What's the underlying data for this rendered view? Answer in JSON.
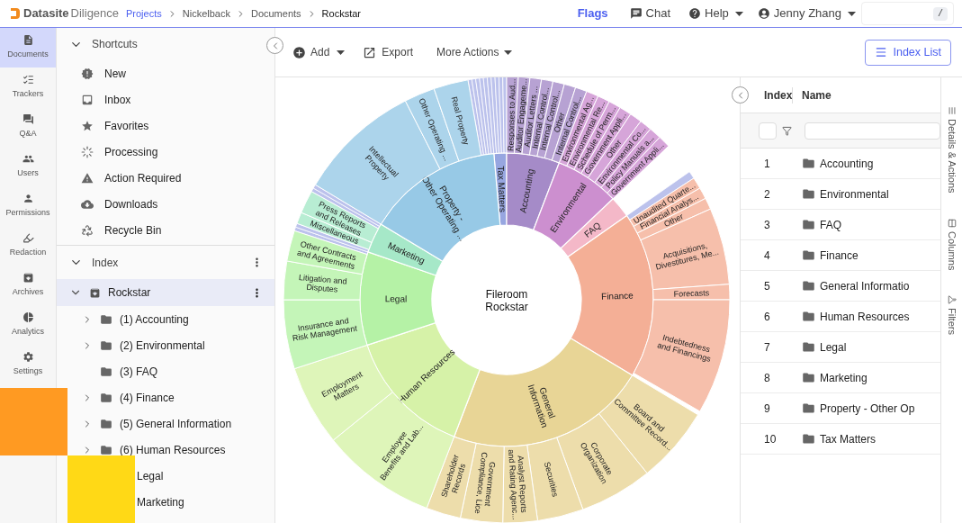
{
  "header": {
    "brand": "Datasite",
    "product": "Diligence",
    "breadcrumb": [
      {
        "label": "Projects",
        "link": true
      },
      {
        "label": "Nickelback",
        "link": false
      },
      {
        "label": "Documents",
        "link": false
      },
      {
        "label": "Rockstar",
        "link": false
      }
    ],
    "flags": "Flags",
    "chat": "Chat",
    "help": "Help",
    "user": "Jenny Zhang",
    "search_shortcut": "/"
  },
  "nav_rail": [
    {
      "label": "Documents",
      "selected": true
    },
    {
      "label": "Trackers",
      "selected": false
    },
    {
      "label": "Q&A",
      "selected": false
    },
    {
      "label": "Users",
      "selected": false
    },
    {
      "label": "Permissions",
      "selected": false
    },
    {
      "label": "Redaction",
      "selected": false
    },
    {
      "label": "Archives",
      "selected": false
    },
    {
      "label": "Analytics",
      "selected": false
    },
    {
      "label": "Settings",
      "selected": false
    }
  ],
  "shortcuts": {
    "title": "Shortcuts",
    "expanded": true,
    "items": [
      "New",
      "Inbox",
      "Favorites",
      "Processing",
      "Action Required",
      "Downloads",
      "Recycle Bin"
    ]
  },
  "index_tree": {
    "title": "Index",
    "expanded": true,
    "root": {
      "label": "Rockstar",
      "expanded": true,
      "selected": true,
      "children": [
        {
          "label": "(1) Accounting",
          "kind": "folder",
          "expandable": true
        },
        {
          "label": "(2) Environmental",
          "kind": "folder",
          "expandable": true
        },
        {
          "label": "(3) FAQ",
          "kind": "folder",
          "expandable": false
        },
        {
          "label": "(4) Finance",
          "kind": "folder",
          "expandable": true
        },
        {
          "label": "(5) General Information",
          "kind": "folder",
          "expandable": true
        },
        {
          "label": "(6) Human Resources",
          "kind": "folder",
          "expandable": true
        },
        {
          "label": "Legal",
          "kind": "covered"
        },
        {
          "label": "Marketing",
          "kind": "covered"
        }
      ]
    }
  },
  "toolbar": {
    "add": "Add",
    "export": "Export",
    "more": "More Actions",
    "index_list": "Index List"
  },
  "chart": {
    "center_lines": [
      "Fileroom",
      "Rockstar"
    ],
    "categories": [
      {
        "lines": [
          "Tax Matters"
        ],
        "color": "#97a6e0"
      },
      {
        "lines": [
          "Accounting"
        ],
        "color": "#a58bc8",
        "children": [
          {
            "lines": [
              "Responses to Aud..."
            ]
          },
          {
            "lines": [
              "Auditor Engageme..."
            ]
          },
          {
            "lines": [
              "Auditor Letters ..."
            ]
          },
          {
            "lines": [
              "Internal Control..."
            ]
          },
          {
            "lines": [
              "Internal Control..."
            ]
          },
          {
            "lines": [
              "Other"
            ]
          },
          {
            "lines": [
              "Internal Control..."
            ]
          }
        ]
      },
      {
        "lines": [
          "Environmental"
        ],
        "color": "#cc8fcf",
        "children": [
          {
            "lines": [
              "Environmental Ag..."
            ]
          },
          {
            "lines": [
              "Environmental Re..."
            ]
          },
          {
            "lines": [
              "Schedule of Perm..."
            ]
          },
          {
            "lines": [
              "Government Appli..."
            ]
          },
          {
            "lines": [
              "Other"
            ]
          },
          {
            "lines": [
              "Environmental Co..."
            ]
          },
          {
            "lines": [
              "Policy Manuals a..."
            ]
          },
          {
            "lines": [
              "Government Appli..."
            ]
          }
        ]
      },
      {
        "lines": [
          "FAQ"
        ],
        "color": "#f4b8c8"
      },
      {
        "lines": [
          "Finance"
        ],
        "color": "#f4af96",
        "children": [
          {
            "lines": [
              "Unaudited Quarte..."
            ]
          },
          {
            "lines": [
              "Financial Analys..."
            ]
          },
          {
            "lines": [
              "Other"
            ]
          },
          {
            "lines": [
              "Acquisitions,",
              "Divestitures, Me..."
            ]
          },
          {
            "lines": [
              "Forecasts"
            ]
          },
          {
            "lines": [
              "Indebtedness",
              "and Financings"
            ]
          }
        ]
      },
      {
        "lines": [
          "General",
          "Information"
        ],
        "color": "#e8d596",
        "children": [
          {
            "lines": [
              "Board and",
              "Committee Record..."
            ]
          },
          {
            "lines": [
              "Corporate",
              "Organization"
            ]
          },
          {
            "lines": [
              "Securities"
            ]
          },
          {
            "lines": [
              "Analyst Reports",
              "and Rating Agenc..."
            ]
          },
          {
            "lines": [
              "Government",
              "Compliance, Lice"
            ]
          },
          {
            "lines": [
              "Shareholder",
              "Records"
            ]
          }
        ]
      },
      {
        "lines": [
          "Human Resources"
        ],
        "color": "#d6f2a8",
        "children": [
          {
            "lines": [
              "Employee",
              "Benefits and Lab..."
            ]
          },
          {
            "lines": [
              "Employment",
              "Matters"
            ]
          }
        ]
      },
      {
        "lines": [
          "Legal"
        ],
        "color": "#b5f2a6",
        "children": [
          {
            "lines": [
              "Insurance and",
              "Risk Management"
            ]
          },
          {
            "lines": [
              "Litigation and",
              "Disputes"
            ]
          },
          {
            "lines": [
              "Other Contracts",
              "and Agreements"
            ]
          }
        ]
      },
      {
        "lines": [
          "Marketing"
        ],
        "color": "#a6e8c8",
        "children": [
          {
            "lines": [
              "Miscellaneous"
            ]
          },
          {
            "lines": [
              "Press Reports",
              "and Releases"
            ]
          }
        ]
      },
      {
        "lines": [
          "Property -",
          "Other Operating ..."
        ],
        "color": "#97c9e6",
        "children": [
          {
            "lines": [
              "Intellectual",
              "Property"
            ]
          },
          {
            "lines": [
              "Other Operating ..."
            ]
          },
          {
            "lines": [
              "Real Property"
            ]
          }
        ]
      }
    ]
  },
  "table": {
    "columns": [
      "Index",
      "Name"
    ],
    "rows": [
      {
        "index": "1",
        "name": "Accounting"
      },
      {
        "index": "2",
        "name": "Environmental"
      },
      {
        "index": "3",
        "name": "FAQ"
      },
      {
        "index": "4",
        "name": "Finance"
      },
      {
        "index": "5",
        "name": "General Informatio"
      },
      {
        "index": "6",
        "name": "Human Resources"
      },
      {
        "index": "7",
        "name": "Legal"
      },
      {
        "index": "8",
        "name": "Marketing"
      },
      {
        "index": "9",
        "name": "Property - Other Op"
      },
      {
        "index": "10",
        "name": "Tax Matters"
      }
    ]
  },
  "side_tabs": [
    "Details & Actions",
    "Columns",
    "Filters"
  ]
}
